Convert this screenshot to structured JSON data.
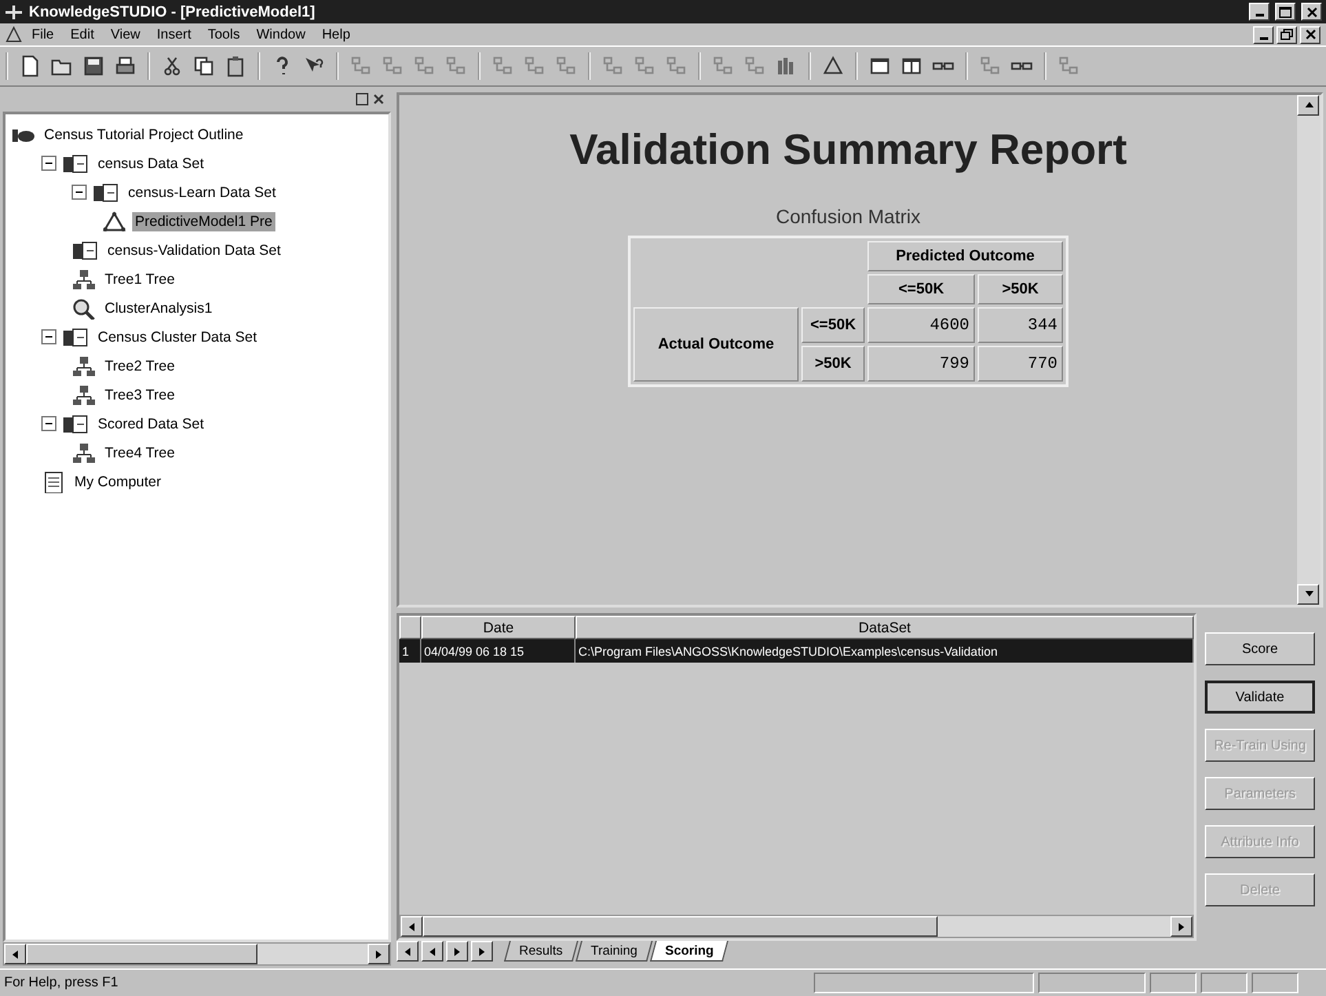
{
  "window": {
    "title": "KnowledgeSTUDIO - [PredictiveModel1]"
  },
  "menu": [
    "File",
    "Edit",
    "View",
    "Insert",
    "Tools",
    "Window",
    "Help"
  ],
  "outline": {
    "items": [
      {
        "kind": "project",
        "label": "Census Tutorial Project Outline",
        "selected": false,
        "children": [
          {
            "kind": "dataset",
            "label": "census Data Set",
            "selected": false,
            "expanded": true,
            "children": [
              {
                "kind": "dataset",
                "label": "census-Learn Data Set",
                "selected": false,
                "expanded": true,
                "children": [
                  {
                    "kind": "model",
                    "label": "PredictiveModel1 Pre",
                    "selected": true
                  }
                ]
              },
              {
                "kind": "dataset",
                "label": "census-Validation Data Set",
                "selected": false
              },
              {
                "kind": "tree",
                "label": "Tree1 Tree",
                "selected": false
              },
              {
                "kind": "cluster",
                "label": "ClusterAnalysis1",
                "selected": false
              }
            ]
          },
          {
            "kind": "dataset",
            "label": "Census Cluster Data Set",
            "selected": false,
            "expanded": true,
            "children": [
              {
                "kind": "tree",
                "label": "Tree2 Tree",
                "selected": false
              },
              {
                "kind": "tree",
                "label": "Tree3 Tree",
                "selected": false
              }
            ]
          },
          {
            "kind": "dataset",
            "label": "Scored Data Set",
            "selected": false,
            "expanded": true,
            "children": [
              {
                "kind": "tree",
                "label": "Tree4 Tree",
                "selected": false
              }
            ]
          },
          {
            "kind": "computer",
            "label": "My Computer",
            "selected": false
          }
        ]
      }
    ]
  },
  "report": {
    "title": "Validation Summary Report",
    "matrix_title": "Confusion Matrix",
    "predicted_label": "Predicted Outcome",
    "actual_label": "Actual Outcome",
    "predicted_classes": [
      "<=50K",
      ">50K"
    ],
    "actual_classes": [
      "<=50K",
      ">50K"
    ],
    "cells": [
      [
        "4600",
        "344"
      ],
      [
        "799",
        "770"
      ]
    ]
  },
  "grid": {
    "columns": [
      "Date",
      "DataSet"
    ],
    "rows": [
      {
        "number": "1",
        "date": "04/04/99 06 18 15",
        "dataset": "C:\\Program Files\\ANGOSS\\KnowledgeSTUDIO\\Examples\\census-Validation",
        "selected": true
      }
    ]
  },
  "actions": [
    {
      "label": "Score",
      "disabled": false,
      "default": false
    },
    {
      "label": "Validate",
      "disabled": false,
      "default": true
    },
    {
      "label": "Re-Train Using",
      "disabled": true,
      "default": false
    },
    {
      "label": "Parameters",
      "disabled": true,
      "default": false
    },
    {
      "label": "Attribute Info",
      "disabled": true,
      "default": false
    },
    {
      "label": "Delete",
      "disabled": true,
      "default": false
    }
  ],
  "tabs": [
    {
      "label": "Results",
      "selected": false
    },
    {
      "label": "Training",
      "selected": false
    },
    {
      "label": "Scoring",
      "selected": true
    }
  ],
  "status_bar": {
    "text": "For Help, press F1"
  }
}
